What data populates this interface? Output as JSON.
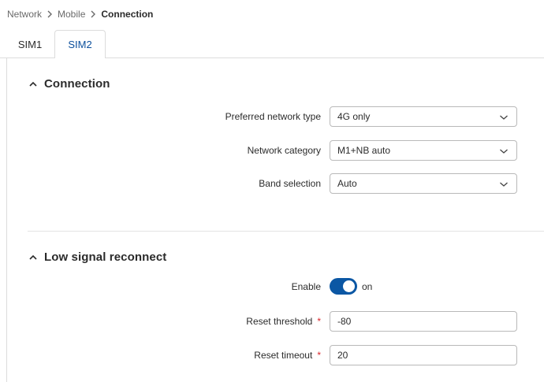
{
  "breadcrumb": {
    "items": [
      "Network",
      "Mobile",
      "Connection"
    ]
  },
  "tabs": {
    "sim1": "SIM1",
    "sim2": "SIM2",
    "active": "SIM2"
  },
  "connection": {
    "title": "Connection",
    "preferred_network_type": {
      "label": "Preferred network type",
      "value": "4G only"
    },
    "network_category": {
      "label": "Network category",
      "value": "M1+NB auto"
    },
    "band_selection": {
      "label": "Band selection",
      "value": "Auto"
    }
  },
  "low_signal": {
    "title": "Low signal reconnect",
    "enable": {
      "label": "Enable",
      "state": "on"
    },
    "reset_threshold": {
      "label": "Reset threshold",
      "value": "-80",
      "required_mark": "*"
    },
    "reset_timeout": {
      "label": "Reset timeout",
      "value": "20",
      "required_mark": "*"
    }
  },
  "colors": {
    "accent": "#0b57a4",
    "active_tab_text": "#0b4f9c",
    "required": "#d9262b"
  }
}
